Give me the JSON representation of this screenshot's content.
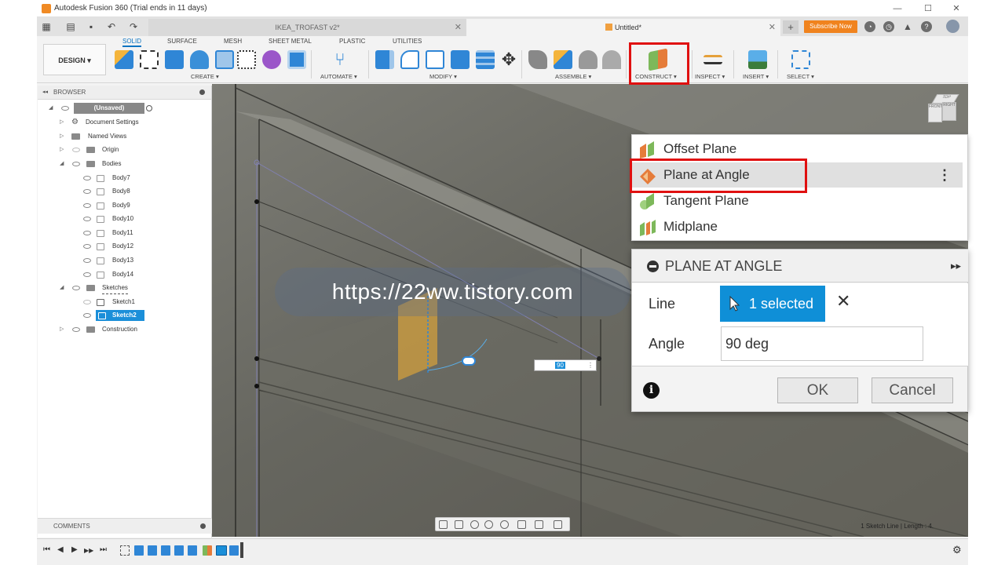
{
  "window": {
    "title": "Autodesk Fusion 360 (Trial ends in 11 days)",
    "minimize": "—",
    "maximize": "☐",
    "close": "✕"
  },
  "tabs": {
    "inactive_label": "IKEA_TROFAST v2*",
    "active_label": "Untitled*",
    "add": "+",
    "subscribe": "Subscribe Now"
  },
  "ribbon": {
    "design_label": "DESIGN ▾",
    "tabs": [
      "SOLID",
      "SURFACE",
      "MESH",
      "SHEET METAL",
      "PLASTIC",
      "UTILITIES"
    ],
    "groups": {
      "create": "CREATE ▾",
      "automate": "AUTOMATE ▾",
      "modify": "MODIFY ▾",
      "assemble": "ASSEMBLE ▾",
      "construct": "CONSTRUCT ▾",
      "inspect": "INSPECT ▾",
      "insert": "INSERT ▾",
      "select": "SELECT ▾"
    }
  },
  "browser": {
    "header": "BROWSER",
    "collapse": "◂◂",
    "root": "(Unsaved)",
    "items": {
      "document_settings": "Document Settings",
      "named_views": "Named Views",
      "origin": "Origin",
      "bodies": "Bodies",
      "body7": "Body7",
      "body8": "Body8",
      "body9": "Body9",
      "body10": "Body10",
      "body11": "Body11",
      "body12": "Body12",
      "body13": "Body13",
      "body14": "Body14",
      "sketches": "Sketches",
      "sketch1": "Sketch1",
      "sketch2": "Sketch2",
      "construction": "Construction"
    },
    "comments": "COMMENTS"
  },
  "viewport": {
    "angle_value": "90",
    "status": "1 Sketch Line | Length : 4.",
    "watermark": "https://22ww.tistory.com",
    "cube_top": "TOP",
    "cube_front": "FRONT",
    "cube_right": "RIGHT"
  },
  "construct_menu": {
    "items": [
      "Offset Plane",
      "Plane at Angle",
      "Tangent Plane",
      "Midplane"
    ],
    "more": "⋮"
  },
  "dialog": {
    "title": "PLANE AT ANGLE",
    "expand": "▸▸",
    "line_label": "Line",
    "line_value": "1 selected",
    "clear": "✕",
    "angle_label": "Angle",
    "angle_value": "90 deg",
    "info": "i",
    "ok": "OK",
    "cancel": "Cancel"
  },
  "timeline": {
    "first": "⏮",
    "prev": "◀",
    "play": "▶",
    "next": "▶▶",
    "last": "⏭",
    "settings": "⚙"
  },
  "colors": {
    "accent": "#0f8fd7",
    "highlight": "#e01010",
    "subscribe": "#f0831e"
  }
}
